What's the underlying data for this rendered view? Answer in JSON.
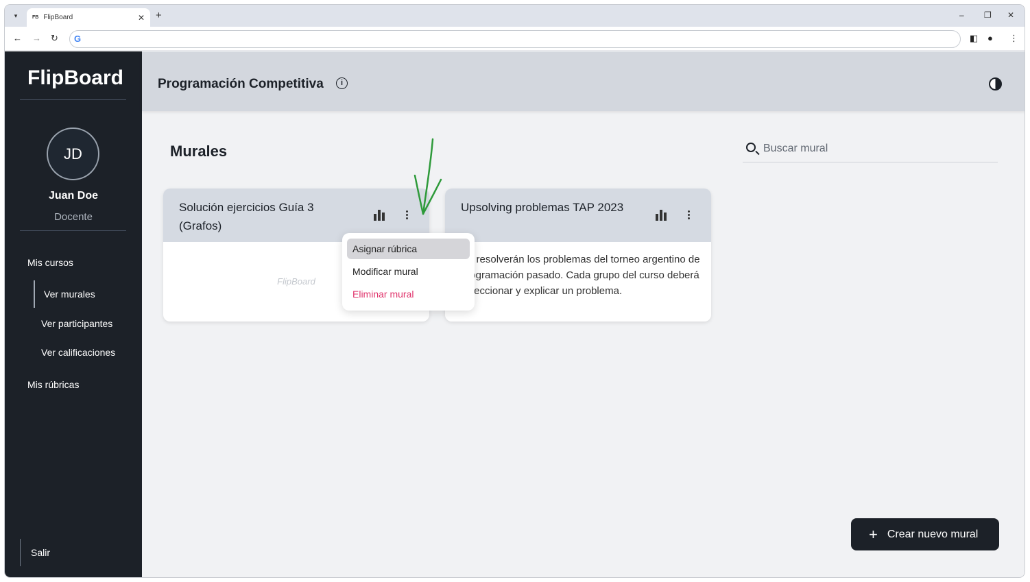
{
  "browser": {
    "tab_title": "FlipBoard",
    "tab_favicon": "FB",
    "tab_close": "✕",
    "new_tab": "+",
    "window_controls": {
      "minimize": "–",
      "restore": "❐",
      "close": "✕"
    },
    "address_value": ""
  },
  "sidebar": {
    "brand": "FlipBoard",
    "avatar_initials": "JD",
    "user_name": "Juan Doe",
    "user_role": "Docente",
    "nav": {
      "courses": "Mis cursos",
      "murals": "Ver murales",
      "participants": "Ver participantes",
      "grades": "Ver calificaciones",
      "rubrics": "Mis rúbricas"
    },
    "logout": "Salir"
  },
  "header": {
    "course_title": "Programación Competitiva",
    "info_glyph": "i"
  },
  "main": {
    "section_title": "Murales",
    "search_placeholder": "Buscar mural",
    "cards": [
      {
        "title": "Solución ejercicios Guía 3 (Grafos)",
        "watermark": "FlipBoard"
      },
      {
        "title": "Upsolving problemas TAP 2023",
        "description": "Se resolverán los problemas del torneo argentino de programación pasado. Cada grupo del curso deberá seleccionar y explicar un problema."
      }
    ],
    "context_menu": {
      "assign": "Asignar rúbrica",
      "edit": "Modificar mural",
      "delete": "Eliminar mural"
    },
    "create_button": "Crear nuevo mural",
    "create_plus": "+"
  },
  "colors": {
    "sidebar_bg": "#1c2128",
    "header_bg": "#d3d7de",
    "card_head_bg": "#d5dae2",
    "danger": "#e0336b",
    "annotation": "#2e9a3a"
  }
}
